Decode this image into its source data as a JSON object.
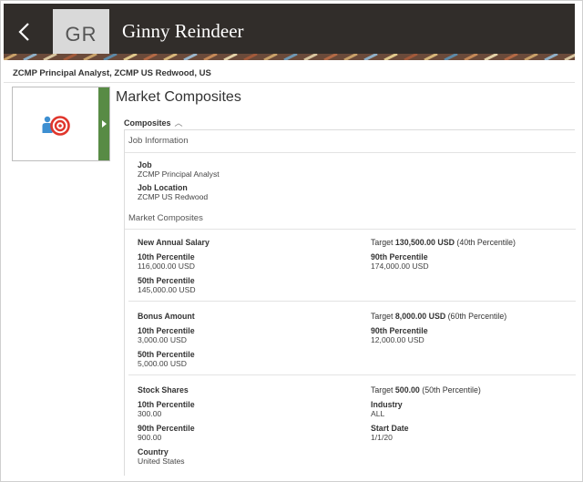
{
  "header": {
    "initials": "GR",
    "name": "Ginny Reindeer"
  },
  "subheader": "ZCMP Principal Analyst, ZCMP US Redwood, US",
  "main": {
    "title": "Market Composites",
    "toggle_label": "Composites",
    "job_section": {
      "heading": "Job Information",
      "job_label": "Job",
      "job_value": "ZCMP Principal Analyst",
      "location_label": "Job Location",
      "location_value": "ZCMP US Redwood"
    },
    "market_heading": "Market Composites",
    "salary": {
      "title": "New Annual Salary",
      "target_prefix": "Target",
      "target_value": "130,500.00 USD",
      "target_suffix": "(40th Percentile)",
      "p10_label": "10th Percentile",
      "p10_value": "116,000.00 USD",
      "p90_label": "90th Percentile",
      "p90_value": "174,000.00 USD",
      "p50_label": "50th Percentile",
      "p50_value": "145,000.00 USD"
    },
    "bonus": {
      "title": "Bonus Amount",
      "target_prefix": "Target",
      "target_value": "8,000.00 USD",
      "target_suffix": "(60th Percentile)",
      "p10_label": "10th Percentile",
      "p10_value": "3,000.00 USD",
      "p90_label": "90th Percentile",
      "p90_value": "12,000.00 USD",
      "p50_label": "50th Percentile",
      "p50_value": "5,000.00 USD"
    },
    "stock": {
      "title": "Stock Shares",
      "target_prefix": "Target",
      "target_value": "500.00",
      "target_suffix": "(50th Percentile)",
      "p10_label": "10th Percentile",
      "p10_value": "300.00",
      "industry_label": "Industry",
      "industry_value": "ALL",
      "p90_label": "90th Percentile",
      "p90_value": "900.00",
      "start_label": "Start Date",
      "start_value": "1/1/20",
      "country_label": "Country",
      "country_value": "United States"
    }
  },
  "colors": {
    "header_bg": "#312d2a",
    "card_accent": "#588b45",
    "icon_red": "#e0362c",
    "icon_blue": "#3d8fd1"
  }
}
